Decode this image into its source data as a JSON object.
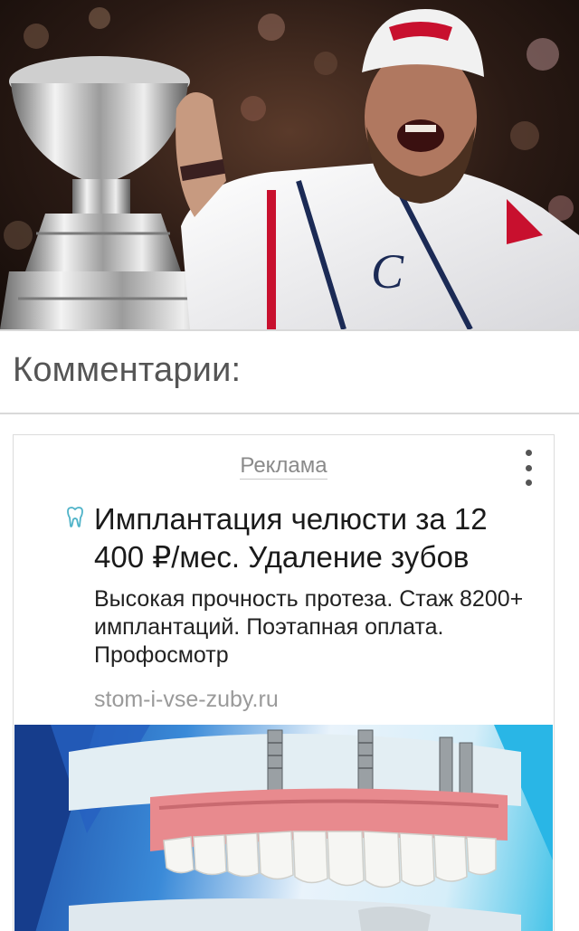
{
  "comments": {
    "title": "Комментарии:"
  },
  "ad": {
    "label": "Реклама",
    "headline": "Имплантация челюсти за 12 400 ₽/мес. Удаление зубов",
    "text": "Высокая прочность протеза. Стаж 8200+ имплантаций. Поэтапная оплата. Профосмотр",
    "domain": "stom-i-vse-zuby.ru"
  },
  "icons": {
    "menu": "more-vertical-icon",
    "brand": "tooth-icon"
  },
  "colors": {
    "accent_icon": "#4fb3c8",
    "text_muted": "#9a9a9a"
  }
}
